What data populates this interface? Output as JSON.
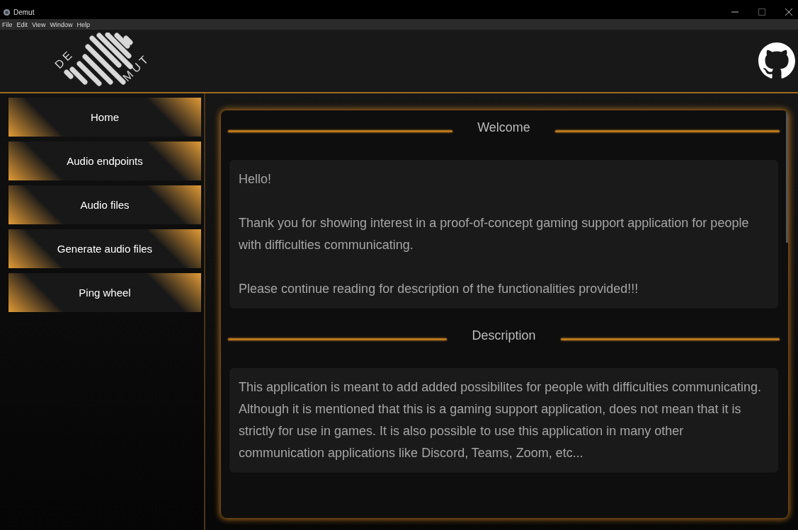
{
  "window": {
    "title": "Demut"
  },
  "menu": [
    "File",
    "Edit",
    "View",
    "Window",
    "Help"
  ],
  "logo": {
    "left": "DE",
    "right": "MUT"
  },
  "sidebar": {
    "items": [
      {
        "label": "Home"
      },
      {
        "label": "Audio endpoints"
      },
      {
        "label": "Audio files"
      },
      {
        "label": "Generate audio files"
      },
      {
        "label": "Ping wheel"
      }
    ]
  },
  "sections": [
    {
      "title": "Welcome",
      "paragraphs": [
        "Hello!",
        "Thank you for showing interest in a proof-of-concept gaming support application for people with difficulties communicating.",
        "Please continue reading for description of the functionalities provided!!!"
      ]
    },
    {
      "title": "Description",
      "paragraphs": [
        "This application is meant to add added possibilites for people with difficulties communicating. Although it is mentioned that this is a gaming support application, does not mean that it is strictly for use in games. It is also possible to use this application in many other communication applications like Discord, Teams, Zoom, etc..."
      ]
    }
  ]
}
